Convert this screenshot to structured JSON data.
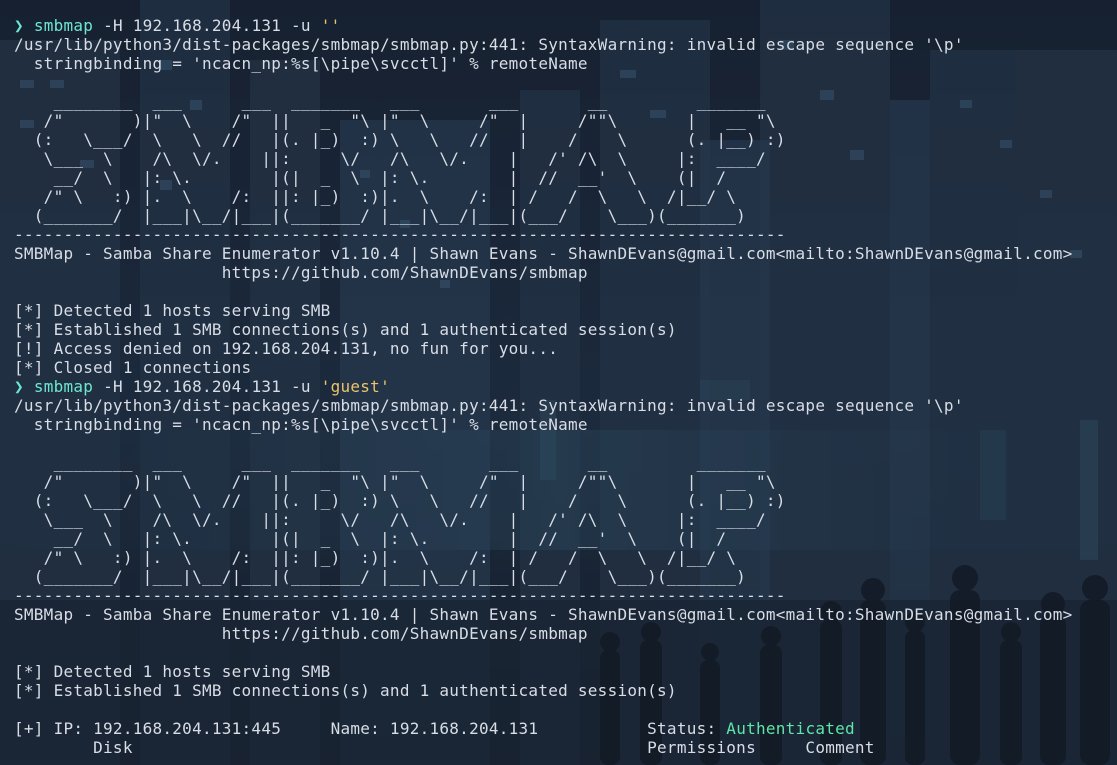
{
  "terminal": {
    "prompt_symbol": "❯",
    "session1": {
      "command": "smbmap",
      "args": " -H 192.168.204.131 -u ",
      "user_arg": "''",
      "warning": "/usr/lib/python3/dist-packages/smbmap/smbmap.py:441: SyntaxWarning: invalid escape sequence '\\p'",
      "warning_code": "  stringbinding = 'ncacn_np:%s[\\pipe\\svcctl]' % remoteName",
      "banner": [
        "    ________  ___      ___  _______   ___       ___       __         _______",
        "   /\"       )|\"  \\    /\"  ||   _  \"\\ |\"  \\     /\"  |     /\"\"\\       |   __ \"\\",
        "  (:   \\___/  \\   \\  //   |(. |_)  :) \\   \\   //   |    /    \\      (. |__) :)",
        "   \\___  \\    /\\  \\/.    ||:     \\/   /\\   \\/.    |   /' /\\  \\     |:  ____/",
        "    __/  \\   |: \\.        |(|  _  \\  |: \\.        |  //  __'  \\    (|  /",
        "   /\" \\   :) |.  \\    /:  ||: |_)  :)|.  \\    /:  | /   /  \\   \\  /|__/ \\",
        "  (_______/  |___|\\__/|___|(_______/ |___|\\__/|___|(___/    \\___)(_______)",
        "------------------------------------------------------------------------------"
      ],
      "title": "SMBMap - Samba Share Enumerator v1.10.4 | Shawn Evans - ShawnDEvans@gmail.com<mailto:ShawnDEvans@gmail.com>",
      "url": "                     https://github.com/ShawnDEvans/smbmap",
      "output": [
        "[*] Detected 1 hosts serving SMB",
        "[*] Established 1 SMB connections(s) and 1 authenticated session(s)",
        "[!] Access denied on 192.168.204.131, no fun for you...",
        "[*] Closed 1 connections"
      ]
    },
    "session2": {
      "command": "smbmap",
      "args": " -H 192.168.204.131 -u ",
      "user_arg": "'guest'",
      "warning": "/usr/lib/python3/dist-packages/smbmap/smbmap.py:441: SyntaxWarning: invalid escape sequence '\\p'",
      "warning_code": "  stringbinding = 'ncacn_np:%s[\\pipe\\svcctl]' % remoteName",
      "title": "SMBMap - Samba Share Enumerator v1.10.4 | Shawn Evans - ShawnDEvans@gmail.com<mailto:ShawnDEvans@gmail.com>",
      "url": "                     https://github.com/ShawnDEvans/smbmap",
      "output": [
        "[*] Detected 1 hosts serving SMB",
        "[*] Established 1 SMB connections(s) and 1 authenticated session(s)"
      ],
      "ip_line_prefix": "[+] IP: 192.168.204.131:445     Name: 192.168.204.131           Status: ",
      "status_value": "Authenticated",
      "header_line": "        Disk                                                    Permissions     Comment"
    },
    "colors": {
      "background": "#1c2a3d",
      "foreground": "#d8dde6",
      "prompt": "#6ee7d1",
      "string": "#e9c46a",
      "status": "#5ee6a8"
    }
  }
}
